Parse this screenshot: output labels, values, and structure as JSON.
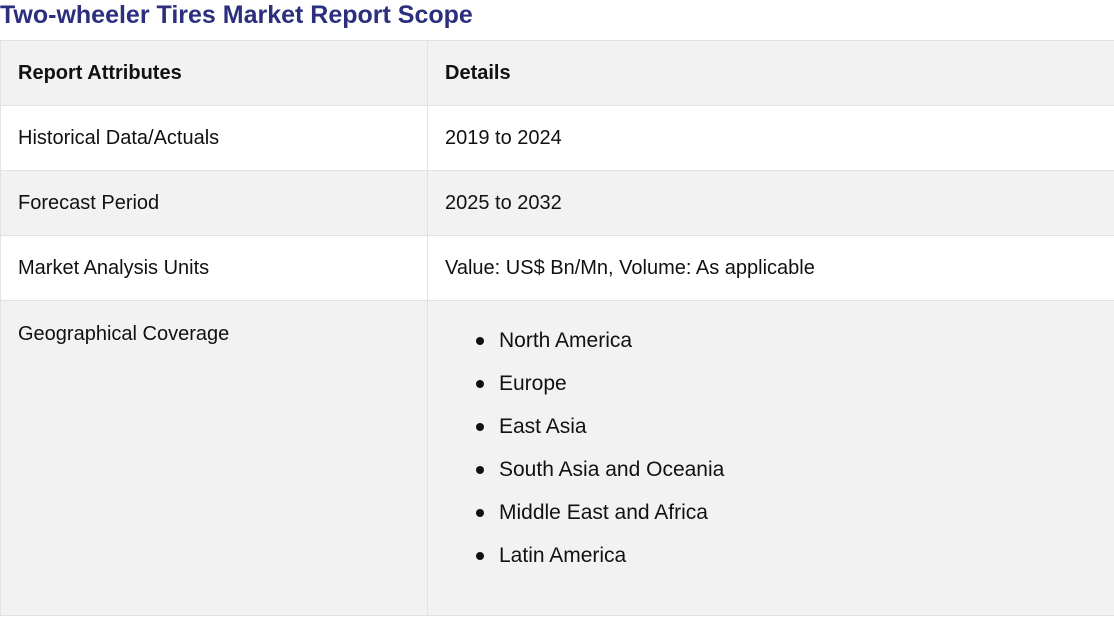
{
  "title": "Two-wheeler Tires Market Report Scope",
  "table": {
    "headers": [
      "Report Attributes",
      "Details"
    ],
    "rows": [
      {
        "attribute": "Historical Data/Actuals",
        "details": "2019 to 2024"
      },
      {
        "attribute": "Forecast Period",
        "details": "2025 to 2032"
      },
      {
        "attribute": "Market Analysis Units",
        "details": "Value: US$ Bn/Mn, Volume: As applicable"
      }
    ],
    "geo": {
      "attribute": "Geographical Coverage",
      "regions": [
        "North America",
        "Europe",
        "East Asia",
        "South Asia and Oceania",
        "Middle East and Africa",
        "Latin America"
      ]
    }
  },
  "colors": {
    "title": "#2b2f7e",
    "row_alt": "#f2f2f2",
    "border": "#e2e2e2"
  }
}
